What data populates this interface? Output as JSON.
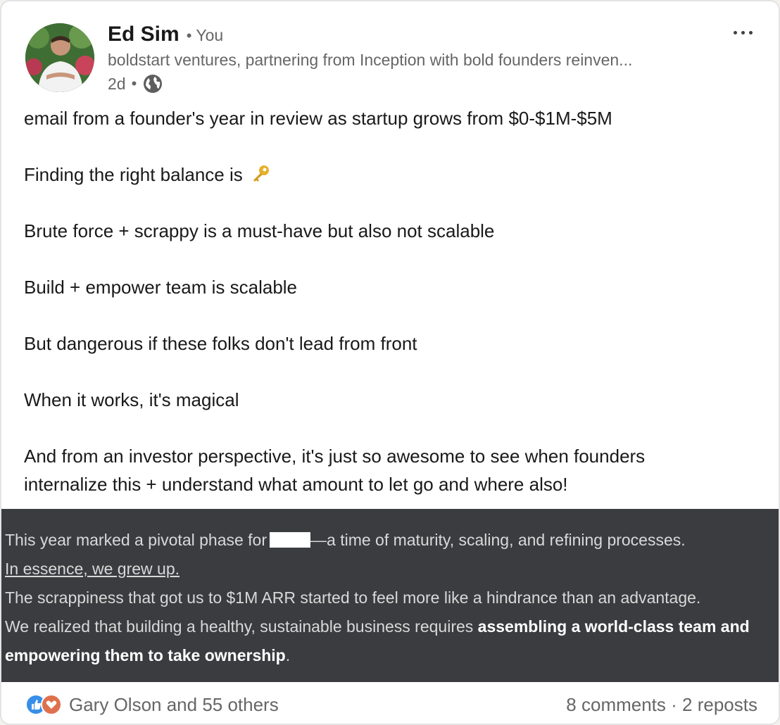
{
  "author": {
    "name": "Ed Sim",
    "relation": "You",
    "headline": "boldstart ventures, partnering from Inception with bold founders reinven...",
    "time": "2d",
    "visibility_icon": "globe-icon"
  },
  "post": {
    "lines": [
      "email from a founder's year in review as startup grows from $0-$1M-$5M",
      "Finding the right balance is",
      "Brute force + scrappy is a must-have but also not scalable",
      "Build + empower team is scalable",
      "But dangerous if these folks don't lead from front",
      "When it works, it's magical",
      "And from an investor perspective, it's just so awesome to see when founders",
      "internalize this + understand what amount to let go and where also!"
    ],
    "emoji": "key-emoji"
  },
  "embed": {
    "line1_before": "This year marked a pivotal phase for",
    "line1_after": "—a time of maturity, scaling, and refining processes.",
    "line2": "In essence, we grew up.",
    "line3": "The scrappiness that got us to $1M ARR started to feel more like a hindrance than an advantage.",
    "line4_plain": "We realized that building a healthy, sustainable business requires ",
    "line4_bold": "assembling a world-class team and",
    "line5_bold": "empowering them to take ownership",
    "line5_end": "."
  },
  "social": {
    "reactions_text": "Gary Olson and 55 others",
    "comments": "8 comments",
    "separator": "·",
    "reposts": "2 reposts"
  },
  "colors": {
    "like": "#378fe9",
    "love": "#df704d",
    "embed_bg": "#3a3c3f"
  }
}
